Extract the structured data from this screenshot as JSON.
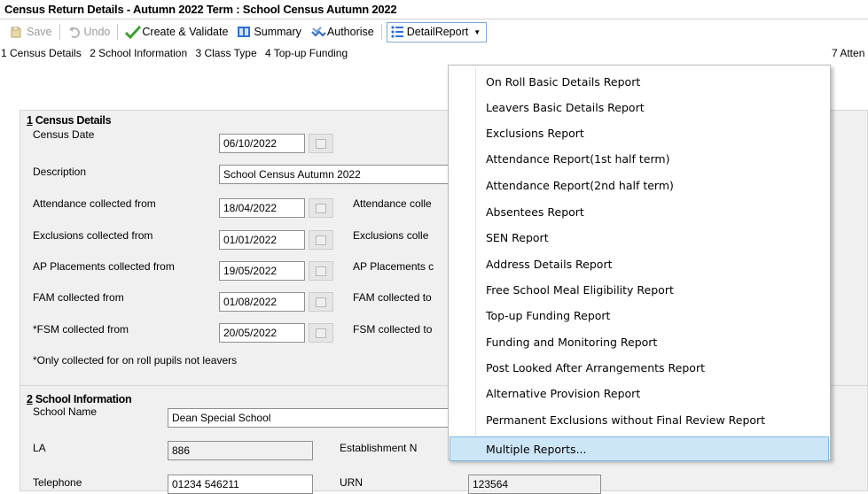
{
  "title": "Census Return Details - Autumn 2022 Term : School Census Autumn 2022",
  "toolbar": {
    "save": "Save",
    "undo": "Undo",
    "create_validate": "Create & Validate",
    "summary": "Summary",
    "authorise": "Authorise",
    "detail_report": "DetailReport"
  },
  "tabs": {
    "t1": "1 Census Details",
    "t2": "2 School Information",
    "t3": "3 Class Type",
    "t4": "4 Top-up Funding",
    "t7": "7 Atten"
  },
  "census": {
    "heading_num": "1",
    "heading_text": " Census Details",
    "census_date_label": "Census Date",
    "census_date": "06/10/2022",
    "description_label": "Description",
    "description": "School Census Autumn 2022",
    "att_from_label": "Attendance collected from",
    "att_from": "18/04/2022",
    "att_to_label": "Attendance colle",
    "exc_from_label": "Exclusions collected from",
    "exc_from": "01/01/2022",
    "exc_to_label": "Exclusions colle",
    "ap_from_label": "AP Placements collected from",
    "ap_from": "19/05/2022",
    "ap_to_label": "AP Placements c",
    "fam_from_label": "FAM collected from",
    "fam_from": "01/08/2022",
    "fam_to_label": "FAM collected to",
    "fsm_from_label": "*FSM collected from",
    "fsm_from": "20/05/2022",
    "fsm_to_label": "FSM collected to",
    "note": "*Only collected for on roll pupils not leavers"
  },
  "school": {
    "heading_num": "2",
    "heading_text": " School Information",
    "name_label": "School Name",
    "name": "Dean Special School",
    "la_label": "LA",
    "la": "886",
    "estab_label": "Establishment N",
    "telephone_label": "Telephone",
    "telephone": "01234 546211",
    "urn_label": "URN",
    "urn": "123564"
  },
  "menu": {
    "items": [
      "On Roll Basic Details Report",
      "Leavers Basic Details Report",
      "Exclusions Report",
      "Attendance Report(1st half term)",
      "Attendance Report(2nd half term)",
      "Absentees Report",
      "SEN Report",
      "Address Details Report",
      "Free School Meal Eligibility Report",
      "Top-up Funding Report",
      "Funding and Monitoring Report",
      "Post Looked After Arrangements Report",
      "Alternative Provision Report",
      "Permanent Exclusions without Final Review Report",
      "Multiple Reports..."
    ],
    "selected_index": 14
  },
  "icons": {
    "save": "save-icon",
    "undo": "undo-icon",
    "create_validate": "checkmark-icon",
    "summary": "summary-icon",
    "authorise": "authorise-icon",
    "detail_report": "list-icon",
    "calendar": "calendar-icon"
  },
  "colors": {
    "menu_highlight": "#cde6f7",
    "menu_highlight_border": "#7bb8e3",
    "panel_bg": "#f0f0f0",
    "check_green": "#3aa02f",
    "summary_blue": "#2f6fd6"
  }
}
